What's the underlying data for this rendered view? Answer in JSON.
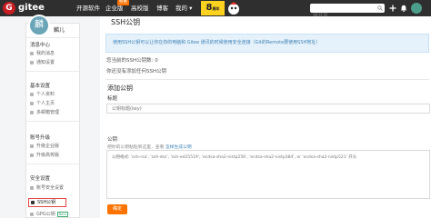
{
  "nav": {
    "logo_mark": "G",
    "logo_text": "gitee",
    "links": [
      "开源软件",
      "企业版",
      "高校版",
      "博客",
      "我的 ▾"
    ],
    "hot_badge": "特惠",
    "promo_big": "8",
    "promo_small": "周年",
    "search_placeholder": "搜开源",
    "icon_names": [
      "search-icon",
      "plus-icon",
      "bell-icon",
      "avatar"
    ]
  },
  "sidebar": {
    "avatar_char": "麟",
    "user_name": "麟儿",
    "groups": [
      {
        "title": "消息中心",
        "items": [
          "我的消息",
          "通知设置"
        ]
      },
      {
        "title": "基本设置",
        "items": [
          "个人资料",
          "个人主页",
          "多邮箱管理"
        ]
      },
      {
        "title": "账号升级",
        "items": [
          "升级企业版",
          "升级高校版"
        ]
      },
      {
        "title": "安全设置",
        "items": [
          "账号安全设置",
          "SSH公钥",
          "GPG公钥"
        ]
      }
    ],
    "active_item": "SSH公钥",
    "beta_label": "Beta",
    "colors": {
      "active_border": "#e54444"
    }
  },
  "main": {
    "title": "SSH公钥",
    "notice": "使用SSH公钥可以让你在你的电脑和 Gitee 通讯的时候使用安全连接（Git的Remote要使用SSH地址）",
    "key_count": "您当前的SSH公钥数: 0",
    "no_key": "你还没有添加任何SSH公钥",
    "add_title": "添加公钥",
    "title_label": "标题",
    "title_placeholder": "公钥标题(key)",
    "key_label": "公钥",
    "hint_prefix": "把你的公钥粘贴到这里，查看 ",
    "hint_link": "怎样生成公钥",
    "key_placeholder": "公钥格式: 'ssh-rsa', 'ssh-dss', 'ssh-ed25519', 'ecdsa-sha2-nistp256', 'ecdsa-sha2-nistp384', or 'ecdsa-sha2-nistp521' 开头",
    "submit": "确定",
    "colors": {
      "accent": "#fe7300",
      "notice_bg": "#e6f2fb",
      "notice_text": "#3f82b6",
      "topbar": "#2f2f2f"
    }
  }
}
